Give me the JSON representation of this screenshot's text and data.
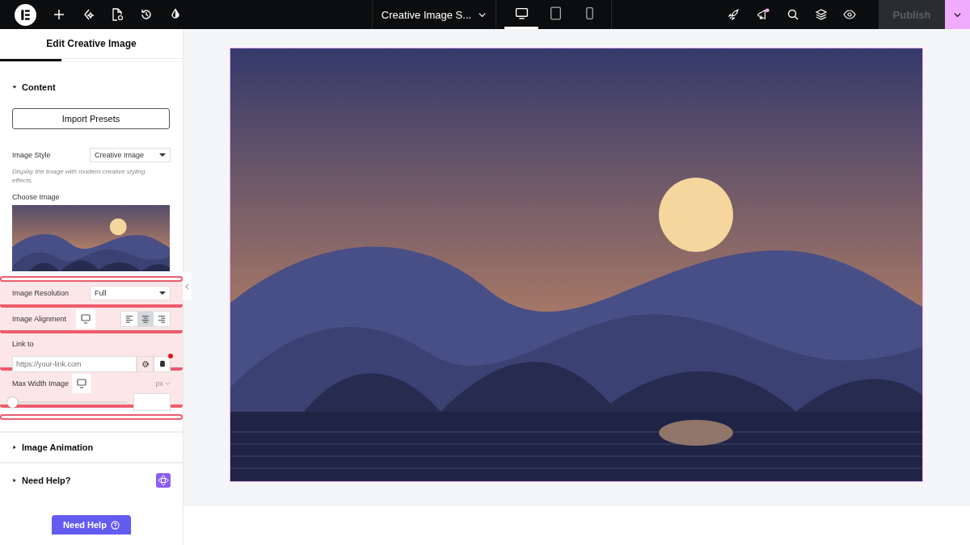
{
  "topbar": {
    "document_title": "Creative Image S...",
    "devices": [
      {
        "kind": "desktop",
        "selected": true
      },
      {
        "kind": "tablet",
        "selected": false
      },
      {
        "kind": "mobile",
        "selected": false
      }
    ],
    "publish": {
      "label": "Publish",
      "disabled": true
    }
  },
  "panel": {
    "title": "Edit Creative Image",
    "content": {
      "title": "Content",
      "expanded": true,
      "import_button": "Import Presets",
      "image_style": {
        "label": "Image Style",
        "value": "Creative Image"
      },
      "hint": "Display the image with modern creative styling effects.",
      "choose_image": "Choose Image",
      "image_resolution": {
        "label": "Image Resolution",
        "value": "Full",
        "highlighted": true
      },
      "image_alignment": {
        "label": "Image Alignment",
        "highlighted": true,
        "options": [
          {
            "kind": "left",
            "selected": false
          },
          {
            "kind": "center",
            "selected": true
          },
          {
            "kind": "right",
            "selected": false
          }
        ]
      },
      "link": {
        "label": "Link to",
        "placeholder": "https://your-link.com",
        "highlighted": true
      },
      "max_width": {
        "label": "Max Width Image",
        "unit": "px",
        "level": 0,
        "highlighted": true
      }
    },
    "sections": [
      {
        "title": "Image Animation",
        "expanded": false
      },
      {
        "title": "Need Help?",
        "expanded": false
      }
    ],
    "help_button": "Need Help"
  }
}
